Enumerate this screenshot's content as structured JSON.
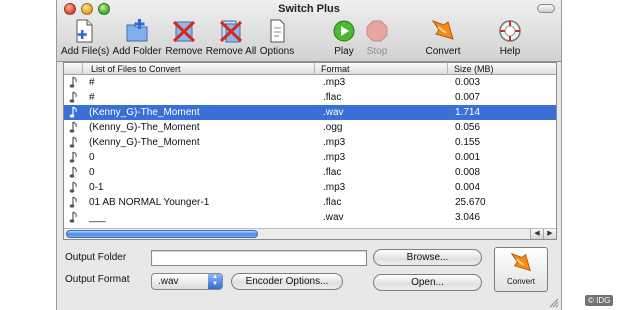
{
  "window": {
    "title": "Switch Plus"
  },
  "toolbar": {
    "items": [
      {
        "label": "Add File(s)",
        "icon": "add-file-icon"
      },
      {
        "label": "Add Folder",
        "icon": "add-folder-icon"
      },
      {
        "label": "Remove",
        "icon": "remove-icon"
      },
      {
        "label": "Remove All",
        "icon": "remove-all-icon"
      },
      {
        "label": "Options",
        "icon": "options-icon"
      },
      {
        "label": "Play",
        "icon": "play-icon"
      },
      {
        "label": "Stop",
        "icon": "stop-icon",
        "disabled": true
      },
      {
        "label": "Convert",
        "icon": "convert-icon"
      },
      {
        "label": "Help",
        "icon": "help-icon"
      }
    ]
  },
  "file_list": {
    "columns": [
      "List of Files to Convert",
      "Format",
      "Size (MB)"
    ],
    "selected_index": 2,
    "rows": [
      {
        "name": "#",
        "format": ".mp3",
        "size": "0.003"
      },
      {
        "name": "#",
        "format": ".flac",
        "size": "0.007"
      },
      {
        "name": "(Kenny_G)-The_Moment",
        "format": ".wav",
        "size": "1.714"
      },
      {
        "name": "(Kenny_G)-The_Moment",
        "format": ".ogg",
        "size": "0.056"
      },
      {
        "name": "(Kenny_G)-The_Moment",
        "format": ".mp3",
        "size": "0.155"
      },
      {
        "name": "0",
        "format": ".mp3",
        "size": "0.001"
      },
      {
        "name": "0",
        "format": ".flac",
        "size": "0.008"
      },
      {
        "name": "0-1",
        "format": ".mp3",
        "size": "0.004"
      },
      {
        "name": "01 AB NORMAL Younger-1",
        "format": ".flac",
        "size": "25.670"
      },
      {
        "name": "___",
        "format": ".wav",
        "size": "3.046"
      }
    ]
  },
  "output": {
    "folder_label": "Output Folder",
    "folder_value": "",
    "format_label": "Output Format",
    "format_value": ".wav",
    "encoder_options_label": "Encoder Options...",
    "browse_label": "Browse...",
    "open_label": "Open...",
    "convert_label": "Convert"
  },
  "watermark": "© IDG",
  "colors": {
    "selection": "#3a6fd8",
    "accent_blue": "#2f6bd6"
  }
}
